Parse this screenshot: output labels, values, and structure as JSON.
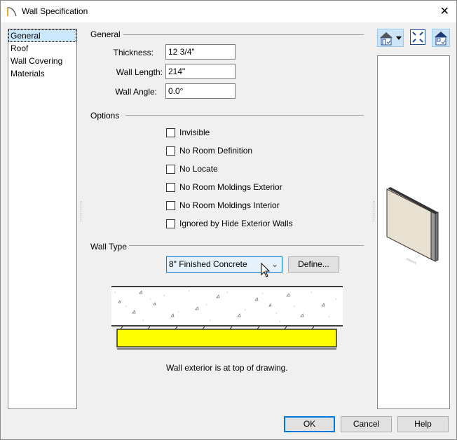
{
  "window": {
    "title": "Wall Specification",
    "close": "✕"
  },
  "nav": {
    "items": [
      {
        "label": "General",
        "selected": true
      },
      {
        "label": "Roof"
      },
      {
        "label": "Wall Covering"
      },
      {
        "label": "Materials"
      }
    ]
  },
  "general": {
    "heading": "General",
    "thickness": {
      "label": "Thickness:",
      "value": "12 3/4\""
    },
    "length": {
      "label": "Wall Length:",
      "value": "214\""
    },
    "angle": {
      "label": "Wall Angle:",
      "value": "0.0°"
    }
  },
  "options": {
    "heading": "Options",
    "items": [
      {
        "label": "Invisible",
        "checked": false
      },
      {
        "label": "No Room Definition",
        "checked": false
      },
      {
        "label": "No Locate",
        "checked": false
      },
      {
        "label": "No Room Moldings Exterior",
        "checked": false
      },
      {
        "label": "No Room Moldings Interior",
        "checked": false
      },
      {
        "label": "Ignored by Hide Exterior Walls",
        "checked": false
      }
    ]
  },
  "walltype": {
    "heading": "Wall Type",
    "selected": "8\" Finished Concrete",
    "define": "Define...",
    "note": "Wall exterior is at top of drawing.",
    "colors": {
      "insulation": "#ffff00"
    }
  },
  "preview": {
    "label": "Interior"
  },
  "buttons": {
    "ok": "OK",
    "cancel": "Cancel",
    "help": "Help"
  }
}
